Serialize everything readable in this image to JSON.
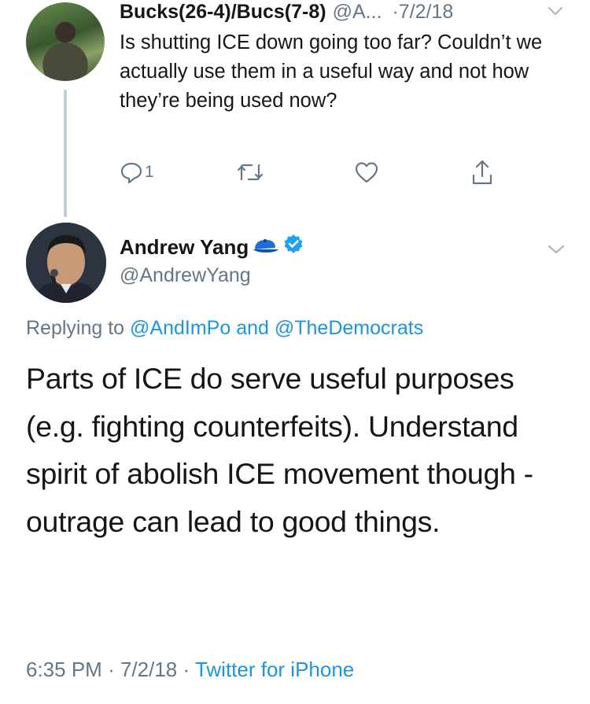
{
  "parent_tweet": {
    "display_name": "Bucks(26-4)/Bucs(7-8)",
    "handle": "@A...",
    "separator": "·",
    "date": "7/2/18",
    "text": "Is shutting ICE down going too far? Couldn’t we actually use them in a useful way and not how they’re being used now?",
    "reply_count": "1",
    "icons": [
      "reply-icon",
      "retweet-icon",
      "like-icon",
      "share-icon"
    ]
  },
  "main_tweet": {
    "display_name": "Andrew Yang",
    "handle": "@AndrewYang",
    "replying_prefix": "Replying to",
    "replying_user_1": "@AndImPo",
    "replying_and": "and",
    "replying_user_2": "@TheDemocrats",
    "text": "Parts of ICE do serve useful purposes (e.g. fighting counterfeits). Understand spirit of abolish ICE movement though - outrage can lead to good things.",
    "time": "6:35 PM",
    "separator": "·",
    "date": "7/2/18",
    "source": "Twitter for iPhone"
  },
  "colors": {
    "link": "#1b95e0",
    "secondary_text": "#657786",
    "primary_text": "#14171a",
    "verified": "#1da1f2",
    "thread_line": "#c4cfd6"
  }
}
